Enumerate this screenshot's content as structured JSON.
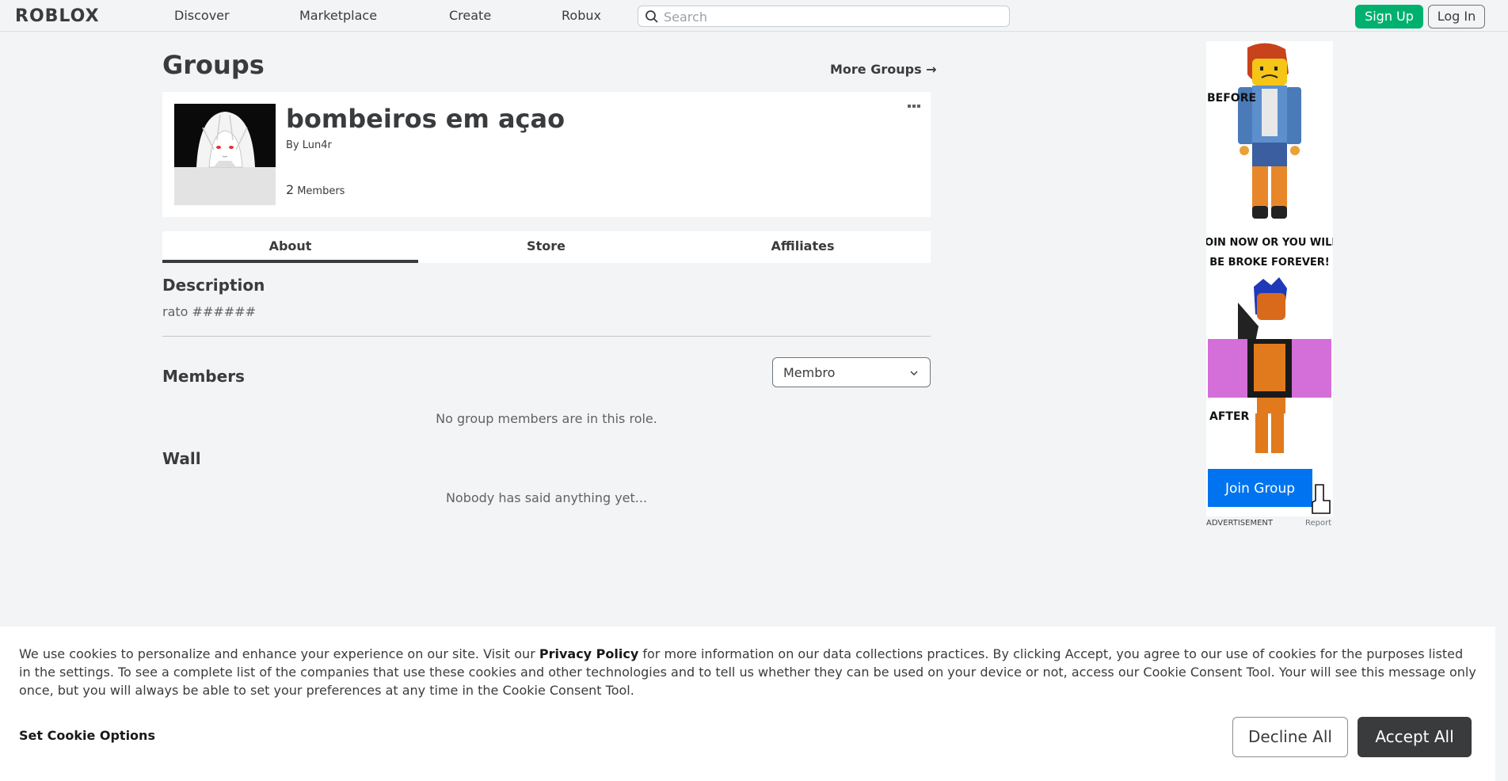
{
  "header": {
    "logo": "ROBLOX",
    "nav": [
      "Discover",
      "Marketplace",
      "Create",
      "Robux"
    ],
    "search_placeholder": "Search",
    "signup_label": "Sign Up",
    "login_label": "Log In"
  },
  "page": {
    "title": "Groups",
    "more_groups": "More Groups →"
  },
  "group": {
    "name": "bombeiros em açao",
    "owner_prefix": "By",
    "owner": "Lun4r",
    "member_count": "2",
    "member_label": "Members"
  },
  "tabs": [
    {
      "label": "About",
      "active": true
    },
    {
      "label": "Store",
      "active": false
    },
    {
      "label": "Affiliates",
      "active": false
    }
  ],
  "about": {
    "description_heading": "Description",
    "description_text": "rato ######",
    "members_heading": "Members",
    "role_selected": "Membro",
    "members_empty": "No group members are in this role.",
    "wall_heading": "Wall",
    "wall_empty": "Nobody has said anything yet..."
  },
  "ad": {
    "text_before": "BEFORE",
    "text_main": "JOIN NOW OR YOU WILL BE BROKE FOREVER!",
    "text_after": "AFTER",
    "button": "Join Group",
    "caption": "ADVERTISEMENT",
    "report": "Report"
  },
  "cookie": {
    "text_1": "We use cookies to personalize and enhance your experience on our site. Visit our ",
    "policy_link": "Privacy Policy",
    "text_2": " for more information on our data collections practices. By clicking Accept, you agree to our use of cookies for the purposes listed in the settings. To see a complete list of the companies that use these cookies and other technologies and to tell us whether they can be used on your device or not, access our Cookie Consent Tool. Your will see this message only once, but you will always be able to set your preferences at any time in the Cookie Consent Tool.",
    "set_options": "Set Cookie Options",
    "decline": "Decline All",
    "accept": "Accept All"
  },
  "colors": {
    "signup_green": "#00b06f",
    "accent_dark": "#393b3d",
    "ad_button_blue": "#0074f0"
  }
}
